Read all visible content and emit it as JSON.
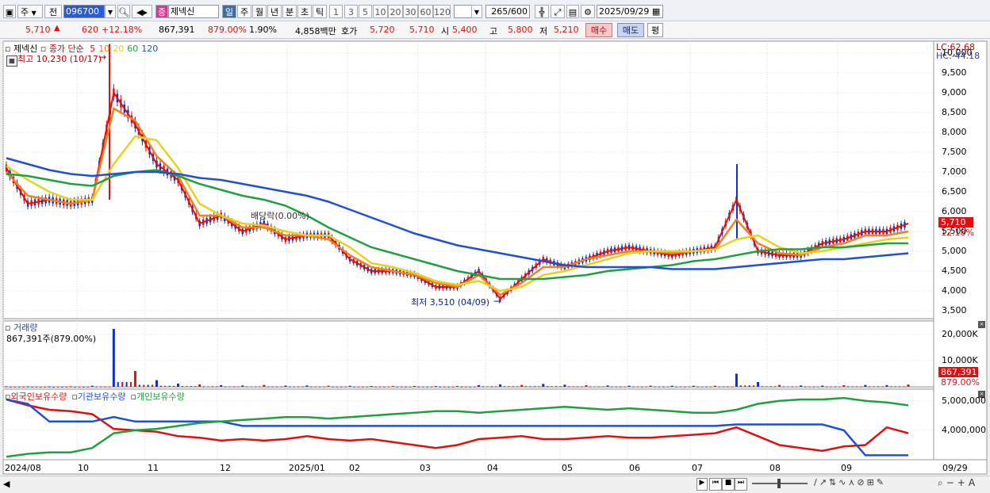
{
  "toolbar": {
    "market": "주",
    "prev_label": "전",
    "code": "096700",
    "badge": "증",
    "name": "제넥신",
    "periods": [
      "일",
      "주",
      "월",
      "년",
      "분",
      "초",
      "틱"
    ],
    "selected_period": "일",
    "intervals": [
      "1",
      "3",
      "5",
      "10",
      "20",
      "30",
      "60",
      "120"
    ],
    "count": "265",
    "count_total": "/600",
    "date": "2025/09/29"
  },
  "quote": {
    "price": "5,710",
    "change": "620",
    "change_pct": "+12.18%",
    "volume": "867,391",
    "volume_ratio": "879.00%",
    "turnover": "1.90%",
    "amount": "4,858백만",
    "bid_label": "호가",
    "bid1": "5,720",
    "bid2": "5,710",
    "open_label": "시",
    "open": "5,400",
    "high_label": "고",
    "high": "5,800",
    "low_label": "저",
    "low": "5,210",
    "buy_label": "매수",
    "sell_label": "매도",
    "eval_label": "평"
  },
  "price_panel": {
    "legend_name": "제넥신",
    "legend_ma_label": "종가 단순",
    "ma_periods": [
      {
        "label": "5",
        "color": "#e01010"
      },
      {
        "label": "10",
        "color": "#f08020"
      },
      {
        "label": "20",
        "color": "#e8d020"
      },
      {
        "label": "60",
        "color": "#20a040"
      },
      {
        "label": "120",
        "color": "#2050d0"
      }
    ],
    "high_annot": "최고 10,230 (10/17)",
    "low_annot": "최저 3,510 (04/09)",
    "dividend_annot": "배당락(0.00%)",
    "lc": "LC:62.68",
    "hc": "HC:-44.18",
    "yticks": [
      "10,000",
      "9,500",
      "9,000",
      "8,500",
      "8,000",
      "7,500",
      "7,000",
      "6,500",
      "6,000",
      "5,500",
      "5,000",
      "4,500",
      "4,000",
      "3,500"
    ],
    "current_price": "5,710",
    "current_pct": "12.18%"
  },
  "volume_panel": {
    "title": "거래량",
    "value": "867,391주(879.00%)",
    "yticks": [
      "20,000K",
      "10,000K"
    ],
    "current": "867,391",
    "current_pct": "879.00%"
  },
  "holding_panel": {
    "legend": [
      {
        "label": "외국인보유수량",
        "color": "#e01010"
      },
      {
        "label": "기관보유수량",
        "color": "#2050d0"
      },
      {
        "label": "개인보유수량",
        "color": "#20a040"
      }
    ],
    "yticks": [
      "5,000,000",
      "4,000,000"
    ]
  },
  "xaxis": {
    "labels": [
      "2024/08",
      "10",
      "11",
      "12",
      "2025/01",
      "02",
      "03",
      "04",
      "05",
      "06",
      "07",
      "08",
      "09",
      "09/29"
    ]
  },
  "chart_data": [
    {
      "type": "line",
      "title": "제넥신",
      "ylim": [
        3300,
        10300
      ],
      "x_labels": [
        "2024/08",
        "10",
        "11",
        "12",
        "2025/01",
        "02",
        "03",
        "04",
        "05",
        "06",
        "07",
        "08",
        "09"
      ],
      "series": [
        {
          "name": "5",
          "values": [
            7100,
            6200,
            6300,
            6200,
            6300,
            9000,
            8200,
            7200,
            6800,
            5700,
            5900,
            5500,
            5700,
            5300,
            5400,
            5400,
            4800,
            4500,
            4500,
            4400,
            4100,
            4100,
            4500,
            3800,
            4300,
            4800,
            4600,
            4800,
            5000,
            5100,
            5000,
            4900,
            5000,
            5100,
            6300,
            5000,
            4900,
            4900,
            5200,
            5300,
            5500,
            5500,
            5700
          ]
        },
        {
          "name": "10",
          "values": [
            7000,
            6400,
            6300,
            6200,
            6300,
            8600,
            8300,
            7400,
            6900,
            5900,
            5900,
            5600,
            5600,
            5400,
            5400,
            5300,
            4900,
            4600,
            4500,
            4400,
            4200,
            4100,
            4400,
            3900,
            4200,
            4600,
            4600,
            4800,
            4900,
            5000,
            5000,
            4950,
            5000,
            5050,
            5800,
            5200,
            4950,
            4900,
            5100,
            5200,
            5400,
            5400,
            5500
          ]
        },
        {
          "name": "20",
          "values": [
            7150,
            6800,
            6500,
            6300,
            6300,
            7200,
            7900,
            7800,
            7100,
            6200,
            5900,
            5700,
            5650,
            5500,
            5400,
            5400,
            5100,
            4700,
            4600,
            4450,
            4250,
            4150,
            4250,
            4000,
            4100,
            4400,
            4500,
            4650,
            4800,
            4950,
            5000,
            5000,
            5000,
            5050,
            5300,
            5400,
            5100,
            4950,
            5000,
            5100,
            5200,
            5300,
            5350
          ]
        },
        {
          "name": "60",
          "values": [
            6950,
            6900,
            6800,
            6700,
            6650,
            6900,
            7000,
            7050,
            6900,
            6700,
            6550,
            6400,
            6300,
            6150,
            5900,
            5600,
            5350,
            5100,
            4950,
            4800,
            4650,
            4500,
            4400,
            4300,
            4300,
            4300,
            4350,
            4400,
            4500,
            4550,
            4600,
            4650,
            4750,
            4800,
            4900,
            5000,
            5050,
            5050,
            5100,
            5100,
            5150,
            5200,
            5200
          ]
        },
        {
          "name": "120",
          "values": [
            7350,
            7200,
            7050,
            6950,
            6900,
            6950,
            7000,
            7000,
            6950,
            6850,
            6800,
            6700,
            6600,
            6500,
            6400,
            6250,
            6050,
            5850,
            5650,
            5450,
            5300,
            5150,
            5050,
            4950,
            4850,
            4750,
            4650,
            4600,
            4600,
            4600,
            4600,
            4550,
            4550,
            4550,
            4600,
            4650,
            4700,
            4750,
            4800,
            4800,
            4850,
            4900,
            4950
          ]
        }
      ]
    },
    {
      "type": "bar",
      "title": "거래량",
      "ylim": [
        0,
        25000
      ],
      "series": [
        {
          "name": "거래량",
          "values": [
            200,
            150,
            120,
            180,
            400,
            22000,
            6000,
            2500,
            1200,
            900,
            600,
            500,
            700,
            450,
            500,
            400,
            350,
            300,
            280,
            300,
            260,
            300,
            600,
            900,
            700,
            1100,
            800,
            600,
            500,
            400,
            450,
            400,
            380,
            420,
            5000,
            1800,
            700,
            500,
            450,
            600,
            700,
            650,
            867
          ]
        }
      ]
    },
    {
      "type": "line",
      "title": "보유수량",
      "ylim": [
        3000000,
        5400000
      ],
      "series": [
        {
          "name": "외국인보유수량",
          "values": [
            5050000,
            4850000,
            4700000,
            4650000,
            4550000,
            4050000,
            4000000,
            3950000,
            3800000,
            3750000,
            3650000,
            3700000,
            3650000,
            3700000,
            3800000,
            3700000,
            3650000,
            3700000,
            3600000,
            3500000,
            3400000,
            3500000,
            3700000,
            3750000,
            3800000,
            3700000,
            3700000,
            3750000,
            3800000,
            3750000,
            3750000,
            3800000,
            3850000,
            3900000,
            4100000,
            3800000,
            3500000,
            3400000,
            3300000,
            3450000,
            3500000,
            4100000,
            3900000
          ]
        },
        {
          "name": "기관보유수량",
          "values": [
            5050000,
            4900000,
            4300000,
            4300000,
            4300000,
            4450000,
            4300000,
            4300000,
            4300000,
            4300000,
            4300000,
            4150000,
            4150000,
            4150000,
            4150000,
            4150000,
            4150000,
            4150000,
            4150000,
            4150000,
            4150000,
            4150000,
            4150000,
            4150000,
            4150000,
            4150000,
            4150000,
            4150000,
            4150000,
            4150000,
            4150000,
            4150000,
            4150000,
            4150000,
            4200000,
            4200000,
            4200000,
            4200000,
            4200000,
            4000000,
            3150000,
            3150000,
            3150000
          ]
        },
        {
          "name": "개인보유수량",
          "values": [
            3100000,
            3200000,
            3250000,
            3250000,
            3400000,
            3900000,
            4000000,
            4050000,
            4150000,
            4250000,
            4300000,
            4350000,
            4400000,
            4450000,
            4450000,
            4400000,
            4450000,
            4500000,
            4550000,
            4600000,
            4650000,
            4650000,
            4600000,
            4650000,
            4700000,
            4750000,
            4800000,
            4750000,
            4700000,
            4750000,
            4700000,
            4650000,
            4600000,
            4600000,
            4700000,
            4900000,
            5000000,
            5050000,
            5050000,
            5100000,
            5000000,
            4950000,
            4850000
          ]
        }
      ]
    }
  ],
  "bottom": {
    "scroll_label": "◀"
  }
}
